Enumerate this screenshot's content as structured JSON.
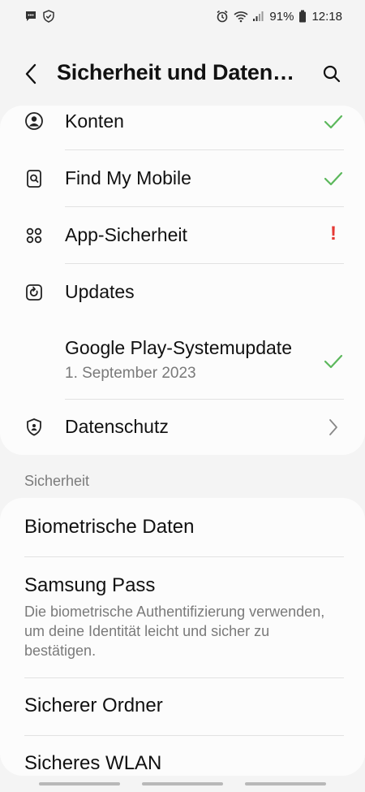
{
  "status_bar": {
    "battery": "91%",
    "time": "12:18"
  },
  "header": {
    "title": "Sicherheit und Daten…"
  },
  "card1": {
    "items": [
      {
        "label": "Konten",
        "icon": "account-circle-icon",
        "trail": "check-icon"
      },
      {
        "label": "Find My Mobile",
        "icon": "find-my-mobile-icon",
        "trail": "check-icon"
      },
      {
        "label": "App-Sicherheit",
        "icon": "apps-grid-icon",
        "trail": "!"
      },
      {
        "label": "Updates",
        "icon": "update-icon",
        "trail": ""
      },
      {
        "label": "Google Play-Systemupdate",
        "sub": "1. September 2023",
        "trail": "check-icon"
      },
      {
        "label": "Datenschutz",
        "icon": "privacy-shield-icon",
        "trail": "chevron-right-icon"
      }
    ]
  },
  "section_security": {
    "header": "Sicherheit",
    "items": [
      {
        "label": "Biometrische Daten"
      },
      {
        "label": "Samsung Pass",
        "description": "Die biometrische Authentifizierung verwenden, um deine Identität leicht und sicher zu bestätigen."
      },
      {
        "label": "Sicherer Ordner"
      },
      {
        "label": "Sicheres WLAN"
      }
    ]
  },
  "colors": {
    "check": "#5cb85c",
    "alert": "#e53935",
    "background": "#f4f4f4",
    "card": "#fcfcfc"
  }
}
